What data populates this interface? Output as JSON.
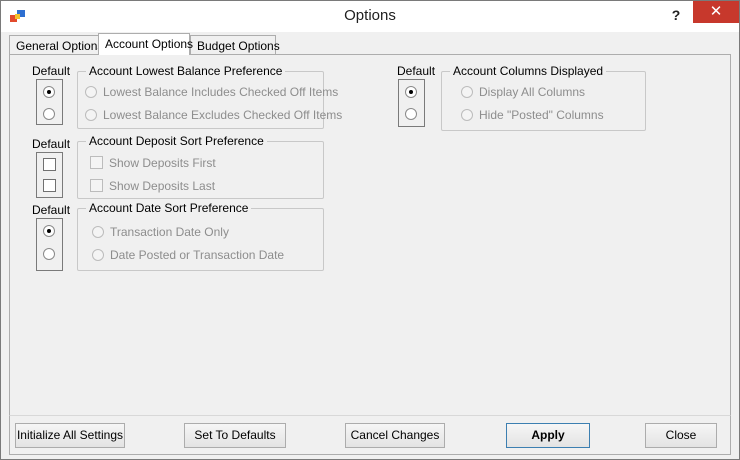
{
  "window": {
    "title": "Options",
    "help_label": "?",
    "close_label": "✕"
  },
  "tabs": [
    {
      "label": "General Options",
      "active": false
    },
    {
      "label": "Account Options",
      "active": true
    },
    {
      "label": "Budget Options",
      "active": false
    }
  ],
  "default_label": "Default",
  "groups": {
    "lowest_balance": {
      "title": "Account Lowest Balance Preference",
      "options": [
        "Lowest Balance Includes Checked Off Items",
        "Lowest Balance Excludes Checked Off Items"
      ],
      "default_selected": 0
    },
    "deposit_sort": {
      "title": "Account Deposit Sort Preference",
      "options": [
        "Show Deposits First",
        "Show Deposits Last"
      ]
    },
    "date_sort": {
      "title": "Account Date Sort Preference",
      "options": [
        "Transaction Date Only",
        "Date Posted or Transaction Date"
      ],
      "default_selected": 0
    },
    "columns": {
      "title": "Account Columns Displayed",
      "options": [
        "Display All Columns",
        "Hide \"Posted\" Columns"
      ],
      "default_selected": 0
    }
  },
  "buttons": {
    "initialize": "Initialize All Settings",
    "set_defaults": "Set To Defaults",
    "cancel": "Cancel Changes",
    "apply": "Apply",
    "close": "Close"
  }
}
